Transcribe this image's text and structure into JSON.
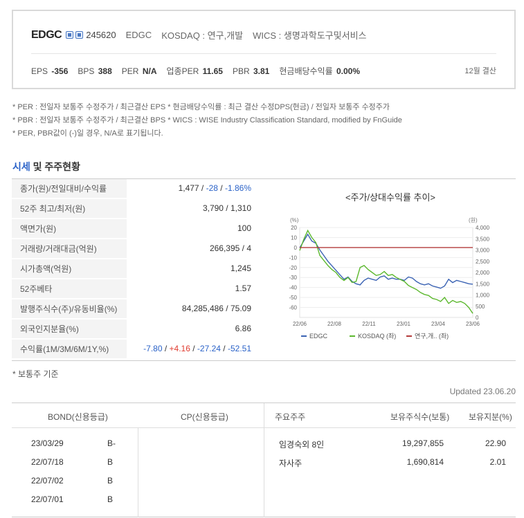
{
  "header": {
    "name": "EDGC",
    "code": "245620",
    "ticker": "EDGC",
    "market": "KOSDAQ : 연구,개발",
    "wics": "WICS : 생명과학도구및서비스",
    "metrics": [
      {
        "label": "EPS",
        "value": "-356"
      },
      {
        "label": "BPS",
        "value": "388"
      },
      {
        "label": "PER",
        "value": "N/A"
      },
      {
        "label": "업종PER",
        "value": "11.65"
      },
      {
        "label": "PBR",
        "value": "3.81"
      },
      {
        "label": "현금배당수익률",
        "value": "0.00%"
      }
    ],
    "settlement": "12월 결산"
  },
  "notes": [
    "* PER : 전일자 보통주 수정주가 / 최근결산 EPS * 현금배당수익률 : 최근 결산 수정DPS(현금) / 전일자 보통주 수정주가",
    "* PBR : 전일자 보통주 수정주가 / 최근결산 BPS * WICS : WISE Industry Classification Standard, modified by FnGuide",
    "* PER, PBR값이 (-)일 경우, N/A로 표기됩니다."
  ],
  "section": {
    "title_a": "시세",
    "title_b": " 및 주주현황"
  },
  "info": [
    {
      "label": "종가(원)/전일대비/수익률",
      "parts": [
        {
          "t": "1,477",
          "c": "v-sep"
        },
        {
          "t": " / ",
          "c": "v-sep"
        },
        {
          "t": "-28",
          "c": "v-neg"
        },
        {
          "t": " / ",
          "c": "v-sep"
        },
        {
          "t": "-1.86%",
          "c": "v-neg"
        }
      ]
    },
    {
      "label": "52주 최고/최저(원)",
      "parts": [
        {
          "t": "3,790 / 1,310",
          "c": "v-sep"
        }
      ]
    },
    {
      "label": "액면가(원)",
      "parts": [
        {
          "t": "100",
          "c": "v-sep"
        }
      ]
    },
    {
      "label": "거래량/거래대금(억원)",
      "parts": [
        {
          "t": "266,395 / 4",
          "c": "v-sep"
        }
      ]
    },
    {
      "label": "시가총액(억원)",
      "parts": [
        {
          "t": "1,245",
          "c": "v-sep"
        }
      ]
    },
    {
      "label": "52주베타",
      "parts": [
        {
          "t": "1.57",
          "c": "v-sep"
        }
      ]
    },
    {
      "label": "발행주식수(주)/유동비율(%)",
      "parts": [
        {
          "t": "84,285,486 / 75.09",
          "c": "v-sep"
        }
      ]
    },
    {
      "label": "외국인지분율(%)",
      "parts": [
        {
          "t": "6.86",
          "c": "v-sep"
        }
      ]
    },
    {
      "label": "수익률(1M/3M/6M/1Y,%)",
      "parts": [
        {
          "t": "-7.80",
          "c": "v-neg"
        },
        {
          "t": " / ",
          "c": "v-sep"
        },
        {
          "t": "+4.16",
          "c": "v-pos"
        },
        {
          "t": " / ",
          "c": "v-sep"
        },
        {
          "t": "-27.24",
          "c": "v-neg"
        },
        {
          "t": " / ",
          "c": "v-sep"
        },
        {
          "t": "-52.51",
          "c": "v-neg"
        }
      ]
    }
  ],
  "chart_data": {
    "type": "line",
    "title": "<주가/상대수익률 추이>",
    "left_unit": "(%)",
    "right_unit": "(원)",
    "left_ticks": [
      "20",
      "10",
      "0",
      "-10",
      "-20",
      "-30",
      "-40",
      "-50",
      "-60"
    ],
    "right_ticks": [
      "4,000",
      "3,500",
      "3,000",
      "2,500",
      "2,000",
      "1,500",
      "1,000",
      "500",
      "0"
    ],
    "x_ticks": [
      "22/06",
      "22/08",
      "22/11",
      "23/01",
      "23/04",
      "23/06"
    ],
    "ylim_left": [
      -70,
      20
    ],
    "ylim_right": [
      0,
      4000
    ],
    "series": [
      {
        "name": "EDGC",
        "axis": "right",
        "color": "#3a62b3",
        "values": [
          3100,
          3400,
          3700,
          3400,
          3300,
          3000,
          2750,
          2500,
          2300,
          2100,
          1900,
          1700,
          1800,
          1600,
          1500,
          1450,
          1650,
          1750,
          1700,
          1650,
          1800,
          1850,
          1700,
          1750,
          1700,
          1700,
          1650,
          1800,
          1750,
          1600,
          1500,
          1450,
          1500,
          1400,
          1350,
          1300,
          1400,
          1700,
          1550,
          1650,
          1600,
          1550,
          1500,
          1480
        ]
      },
      {
        "name": "KOSDAQ (좌)",
        "axis": "left",
        "color": "#5cb82e",
        "values": [
          -3,
          8,
          17,
          10,
          5,
          -8,
          -13,
          -18,
          -22,
          -25,
          -30,
          -33,
          -30,
          -35,
          -34,
          -20,
          -18,
          -22,
          -25,
          -28,
          -27,
          -24,
          -28,
          -27,
          -30,
          -32,
          -34,
          -38,
          -40,
          -42,
          -45,
          -47,
          -48,
          -51,
          -52,
          -54,
          -50,
          -56,
          -53,
          -55,
          -54,
          -56,
          -60,
          -66
        ]
      },
      {
        "name": "연구,개.. (좌)",
        "axis": "left",
        "color": "#b33a3a",
        "values": [
          0,
          0,
          0,
          0,
          0,
          0,
          0,
          0,
          0,
          0,
          0,
          0,
          0,
          0,
          0,
          0,
          0,
          0,
          0,
          0,
          0,
          0,
          0,
          0,
          0,
          0,
          0,
          0,
          0,
          0,
          0,
          0,
          0,
          0,
          0,
          0,
          0,
          0,
          0,
          0,
          0,
          0,
          0,
          0
        ]
      }
    ],
    "legend": [
      "EDGC",
      "KOSDAQ (좌)",
      "연구,개.. (좌)"
    ]
  },
  "footnote": "* 보통주 기준",
  "updated": "Updated 23.06.20",
  "bottom": {
    "h_bond": "BOND(신용등급)",
    "h_cp": "CP(신용등급)",
    "h_holder": "주요주주",
    "h_shares": "보유주식수(보통)",
    "h_pct": "보유지분(%)",
    "bonds": [
      {
        "date": "23/03/29",
        "grade": "B-"
      },
      {
        "date": "22/07/18",
        "grade": "B"
      },
      {
        "date": "22/07/02",
        "grade": "B"
      },
      {
        "date": "22/07/01",
        "grade": "B"
      }
    ],
    "holders": [
      {
        "name": "임경숙외 8인",
        "shares": "19,297,855",
        "pct": "22.90"
      },
      {
        "name": "자사주",
        "shares": "1,690,814",
        "pct": "2.01"
      }
    ]
  }
}
